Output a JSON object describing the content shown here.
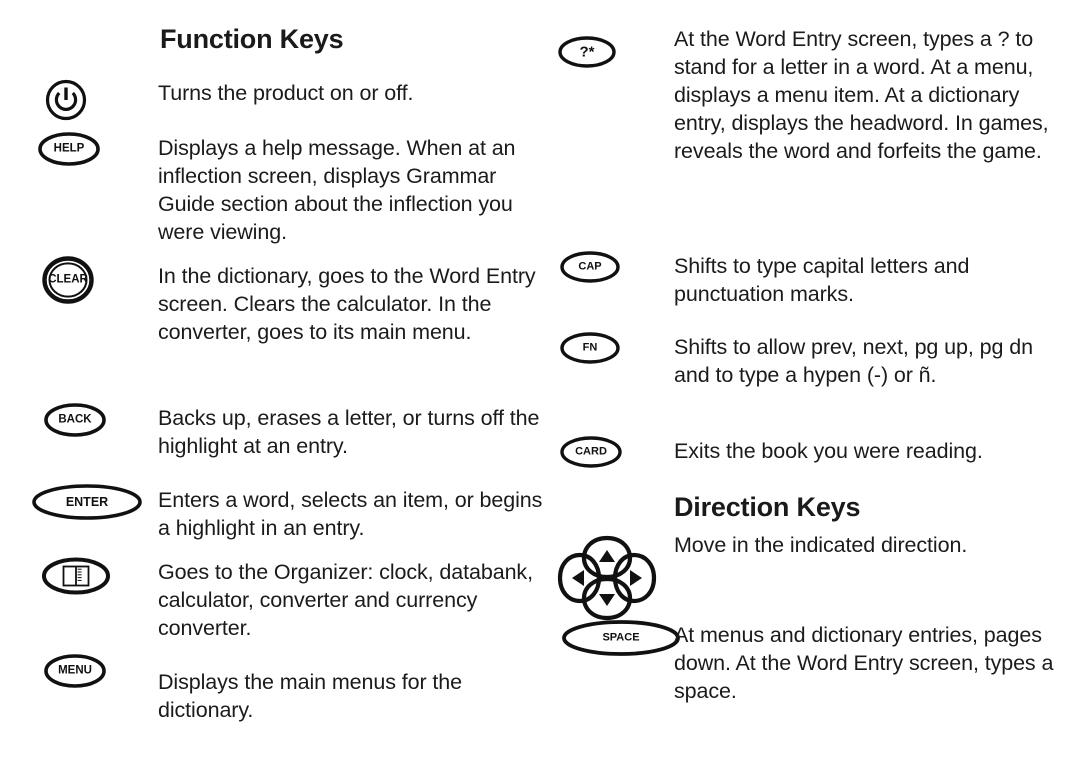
{
  "document": {
    "page_background": "#ffffff",
    "text_color": "#111111"
  },
  "sections": [
    {
      "id": "function-keys",
      "heading": "Function Keys",
      "column": "left"
    },
    {
      "id": "direction-keys",
      "heading": "Direction Keys",
      "column": "right"
    }
  ],
  "left_column": {
    "heading": "Function Keys",
    "entries": [
      {
        "key_name": "power-key",
        "key_label": "",
        "key_shape": "power-circle-icon",
        "description": "Turns the product on or off."
      },
      {
        "key_name": "help-key",
        "key_label": "HELP",
        "key_shape": "oval",
        "description": "Displays a help message. When at an inflection screen, displays Grammar Guide section about the inflection you were viewing."
      },
      {
        "key_name": "clear-key",
        "key_label": "CLEAR",
        "key_shape": "double-circle",
        "description": "In the dictionary, goes to the Word Entry screen. Clears the calculator. In the converter, goes to its main menu."
      },
      {
        "key_name": "back-key",
        "key_label": "BACK",
        "key_shape": "oval",
        "description": "Backs up, erases a letter, or turns off the highlight at an entry."
      },
      {
        "key_name": "enter-key",
        "key_label": "ENTER",
        "key_shape": "wide-oval",
        "description": "Enters a word, selects an item, or begins a highlight in an entry."
      },
      {
        "key_name": "organizer-key",
        "key_label": "",
        "key_shape": "book-oval-icon",
        "description": "Goes to the Organizer: clock, databank, calculator, converter and currency converter."
      },
      {
        "key_name": "menu-key",
        "key_label": "MENU",
        "key_shape": "oval",
        "description": "Displays the main menus for the dictionary."
      }
    ]
  },
  "right_column": {
    "heading": "Direction Keys",
    "entries": [
      {
        "key_name": "question-star-key",
        "key_label": "?*",
        "key_shape": "oval",
        "description": "At the Word Entry screen, types a ? to stand for a letter in a word. At a menu, displays a menu item. At a dictionary entry, displays the headword. In games, reveals the word and forfeits the game."
      },
      {
        "key_name": "cap-key",
        "key_label": "CAP",
        "key_shape": "oval",
        "description": "Shifts to type capital letters and punctuation marks."
      },
      {
        "key_name": "fn-key",
        "key_label": "FN",
        "key_shape": "oval",
        "description": "Shifts to allow prev, next, pg up, pg dn and to type a hypen (-) or ñ."
      },
      {
        "key_name": "card-key",
        "key_label": "CARD",
        "key_shape": "oval",
        "description": "Exits the book you were reading."
      },
      {
        "key_name": "direction-pad",
        "key_label": "",
        "key_shape": "arrow-pad-icon",
        "description": "Move in the indicated direction."
      },
      {
        "key_name": "space-key",
        "key_label": "SPACE",
        "key_shape": "wide-oval",
        "description": "At menus and dictionary entries, pages down. At the Word Entry screen, types a space."
      }
    ]
  }
}
